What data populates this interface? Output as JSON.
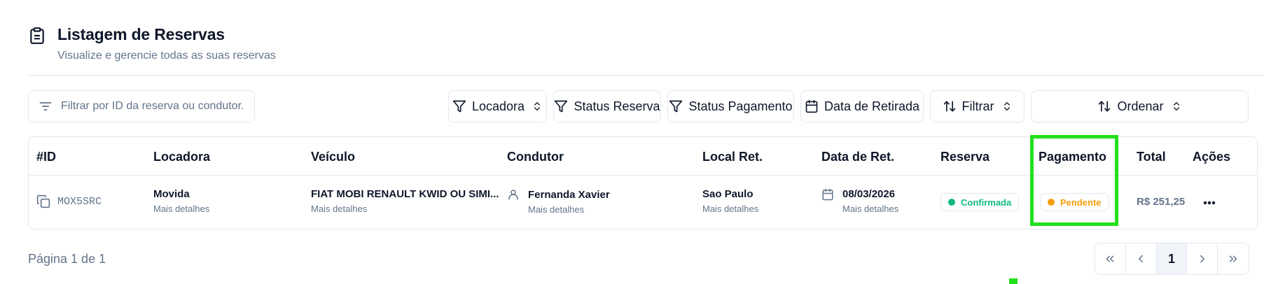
{
  "header": {
    "title": "Listagem de Reservas",
    "subtitle": "Visualize e gerencie todas as suas reservas"
  },
  "search": {
    "placeholder": "Filtrar por ID da reserva ou condutor...",
    "value": ""
  },
  "filters": {
    "locadora": "Locadora",
    "status_reserva": "Status Reserva",
    "status_pagamento": "Status Pagamento",
    "data_retirada": "Data de Retirada",
    "filtrar": "Filtrar",
    "ordenar": "Ordenar"
  },
  "table": {
    "columns": {
      "id": "#ID",
      "locadora": "Locadora",
      "veiculo": "Veículo",
      "condutor": "Condutor",
      "local": "Local Ret.",
      "data": "Data de Ret.",
      "reserva": "Reserva",
      "pagamento": "Pagamento",
      "total": "Total",
      "acoes": "Ações"
    },
    "rows": [
      {
        "id": "MOX5SRC",
        "locadora": "Movida",
        "locadora_sub": "Mais detalhes",
        "veiculo": "FIAT MOBI RENAULT KWID OU SIMI...",
        "veiculo_sub": "Mais detalhes",
        "condutor": "Fernanda Xavier",
        "condutor_sub": "Mais detalhes",
        "local": "Sao Paulo",
        "local_sub": "Mais detalhes",
        "data": "08/03/2026",
        "data_sub": "Mais detalhes",
        "reserva": "Confirmada",
        "pagamento": "Pendente",
        "total": "R$ 251,25"
      }
    ]
  },
  "pagination": {
    "info": "Página 1 de 1",
    "current": "1"
  },
  "colors": {
    "confirmed": "#10b981",
    "pending": "#f59e0b",
    "highlight": "#22e01c"
  }
}
